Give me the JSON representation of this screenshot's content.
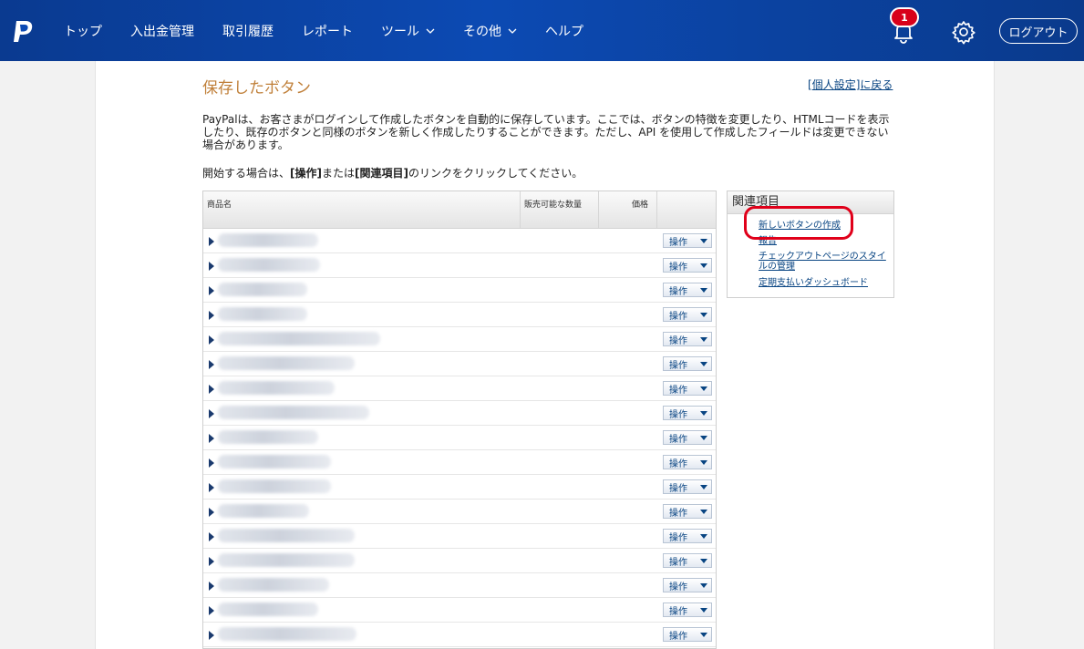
{
  "nav": {
    "items": [
      {
        "label": "トップ",
        "has_dropdown": false
      },
      {
        "label": "入出金管理",
        "has_dropdown": false
      },
      {
        "label": "取引履歴",
        "has_dropdown": false
      },
      {
        "label": "レポート",
        "has_dropdown": false
      },
      {
        "label": "ツール",
        "has_dropdown": true
      },
      {
        "label": "その他",
        "has_dropdown": true
      },
      {
        "label": "ヘルプ",
        "has_dropdown": false
      }
    ],
    "notification_count": "1",
    "logout_label": "ログアウト",
    "bg_color": "#0c4ab3"
  },
  "page": {
    "title": "保存したボタン",
    "back_link": {
      "open": "[",
      "label": "個人設定",
      "close": "]",
      "suffix": "に戻る"
    },
    "description": "PayPalは、お客さまがログインして作成したボタンを自動的に保存しています。ここでは、ボタンの特徴を変更したり、HTMLコードを表示したり、既存のボタンと同様のボタンを新しく作成したりすることができます。ただし、API を使用して作成したフィールドは変更できない場合があります。",
    "instruction": {
      "pre": "開始する場合は、",
      "b1": "[操作]",
      "mid": "または",
      "b2": "[関連項目]",
      "post": "のリンクをクリックしてください。"
    }
  },
  "table": {
    "headers": {
      "name": "商品名",
      "qty": "販売可能な数量",
      "price": "価格"
    },
    "action_label": "操作",
    "rows": [
      {
        "name": ""
      },
      {
        "name": ""
      },
      {
        "name": ""
      },
      {
        "name": ""
      },
      {
        "name": ""
      },
      {
        "name": ""
      },
      {
        "name": ""
      },
      {
        "name": ""
      },
      {
        "name": ""
      },
      {
        "name": ""
      },
      {
        "name": ""
      },
      {
        "name": ""
      },
      {
        "name": ""
      },
      {
        "name": ""
      },
      {
        "name": ""
      },
      {
        "name": ""
      },
      {
        "name": ""
      }
    ]
  },
  "related": {
    "title": "関連項目",
    "links": [
      {
        "label": "新しいボタンの作成"
      },
      {
        "label": "報告"
      },
      {
        "label": "チェックアウトページのスタイルの管理"
      },
      {
        "label": "定期支払いダッシュボード"
      }
    ],
    "highlight_color": "#e0001a"
  }
}
